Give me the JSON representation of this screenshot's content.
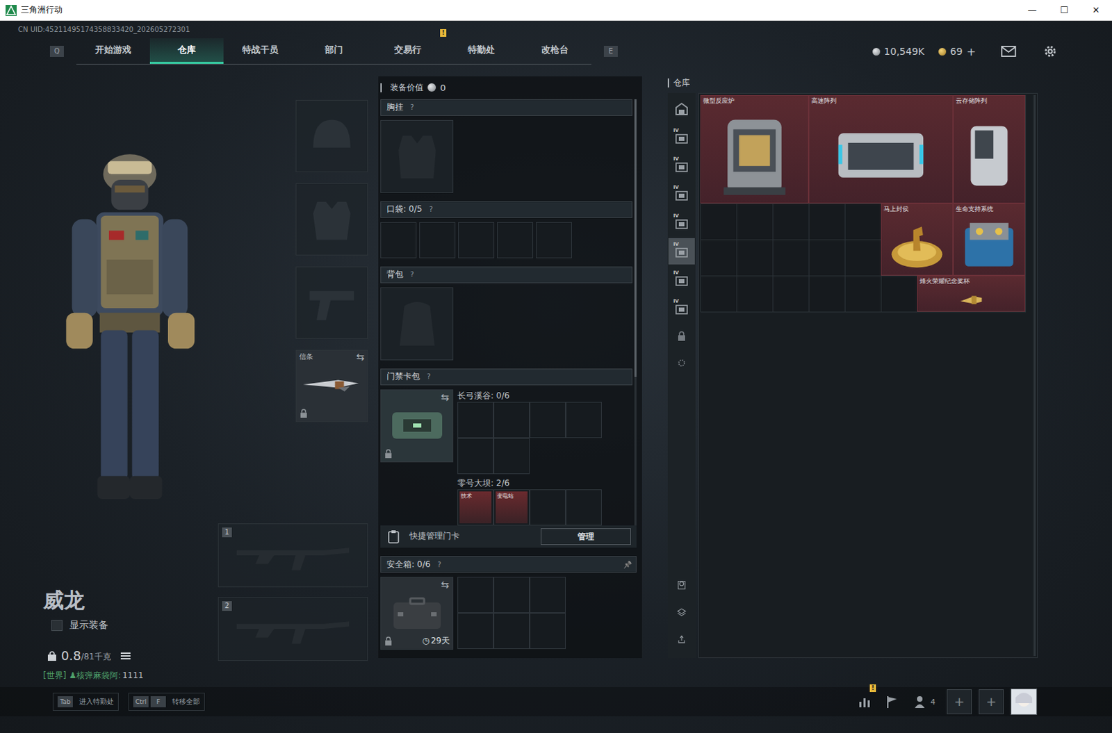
{
  "window": {
    "title": "三角洲行动",
    "controls": [
      "—",
      "☐",
      "✕"
    ]
  },
  "uid": "CN UID:45211495174358833420_202605272301",
  "nav": {
    "prev_key": "Q",
    "next_key": "E",
    "alert_mark": "!",
    "tabs": [
      {
        "label": "开始游戏",
        "selected": false,
        "alert": false
      },
      {
        "label": "仓库",
        "selected": true,
        "alert": false
      },
      {
        "label": "特战干员",
        "selected": false,
        "alert": false
      },
      {
        "label": "部门",
        "selected": false,
        "alert": false
      },
      {
        "label": "交易行",
        "selected": false,
        "alert": false
      },
      {
        "label": "特勤处",
        "selected": false,
        "alert": true
      },
      {
        "label": "改枪台",
        "selected": false,
        "alert": false
      }
    ]
  },
  "currency": {
    "coins": "10,549K",
    "tokens": "69",
    "add": "+"
  },
  "operator": {
    "name": "威龙",
    "show_gear": {
      "label": "显示装备",
      "checked": false
    },
    "weight": "0.8",
    "capacity": "/81千克",
    "chat": {
      "channel": "[世界]",
      "sender": "核弹麻袋阿:",
      "text": "1111"
    }
  },
  "gear_slots": [
    {
      "kind": "helmet",
      "filled": false,
      "label": "",
      "locked": false
    },
    {
      "kind": "armor",
      "filled": false,
      "label": "",
      "locked": false
    },
    {
      "kind": "pistol",
      "filled": false,
      "label": "",
      "locked": false
    },
    {
      "kind": "melee",
      "filled": true,
      "label": "信条",
      "locked": true
    }
  ],
  "weapon_slots": [
    {
      "number": "1"
    },
    {
      "number": "2"
    }
  ],
  "loadout": {
    "value_label": "装备价值",
    "value": "0",
    "chest": {
      "title": "胸挂",
      "help": "?"
    },
    "pockets": {
      "title": "口袋:",
      "count": "0/5",
      "help": "?",
      "slots": 5
    },
    "backpack": {
      "title": "背包",
      "help": "?"
    },
    "keycards": {
      "title": "门禁卡包",
      "help": "?",
      "locked": true,
      "maps": [
        {
          "name": "长弓溪谷:",
          "count": "0/6",
          "slots": 6,
          "cards": []
        },
        {
          "name": "零号大坝:",
          "count": "2/6",
          "slots": 6,
          "cards": [
            "技术",
            "变电站"
          ]
        }
      ]
    },
    "quick_manage": {
      "label": "快捷管理门卡",
      "button": "管理"
    },
    "safe": {
      "title": "安全箱:",
      "count": "0/6",
      "help": "?",
      "locked": true,
      "expires": "29天",
      "slots": 6
    }
  },
  "warehouse": {
    "title": "仓库",
    "tabs": [
      {
        "kind": "all",
        "tier": "",
        "selected": false
      },
      {
        "kind": "ext",
        "tier": "IV",
        "selected": false
      },
      {
        "kind": "ext",
        "tier": "IV",
        "selected": false
      },
      {
        "kind": "ext",
        "tier": "IV",
        "selected": false
      },
      {
        "kind": "ext",
        "tier": "IV",
        "selected": false
      },
      {
        "kind": "ext",
        "tier": "IV",
        "selected": true
      },
      {
        "kind": "ext",
        "tier": "IV",
        "selected": false
      },
      {
        "kind": "ext",
        "tier": "IV",
        "selected": false
      },
      {
        "kind": "lock",
        "tier": "",
        "selected": false
      },
      {
        "kind": "settings",
        "tier": "",
        "selected": false
      }
    ],
    "tools": [
      "operator",
      "layers",
      "transfer"
    ],
    "items": [
      {
        "name": "微型反应炉",
        "kind": "reactor"
      },
      {
        "name": "高速阵列",
        "kind": "array"
      },
      {
        "name": "云存储阵列",
        "kind": "cloud"
      },
      {
        "name": "马上封侯",
        "kind": "horse"
      },
      {
        "name": "生命支持系统",
        "kind": "life"
      },
      {
        "name": "烽火荣耀纪念奖杯",
        "kind": "trophy"
      }
    ]
  },
  "bottom": {
    "hints": [
      {
        "keys": [
          "Tab"
        ],
        "label": "进入特勤处"
      },
      {
        "keys": [
          "Ctrl",
          "F"
        ],
        "label": "转移全部"
      }
    ],
    "alert_mark": "!",
    "friends": "4",
    "party_slots": [
      "+",
      "+"
    ]
  }
}
